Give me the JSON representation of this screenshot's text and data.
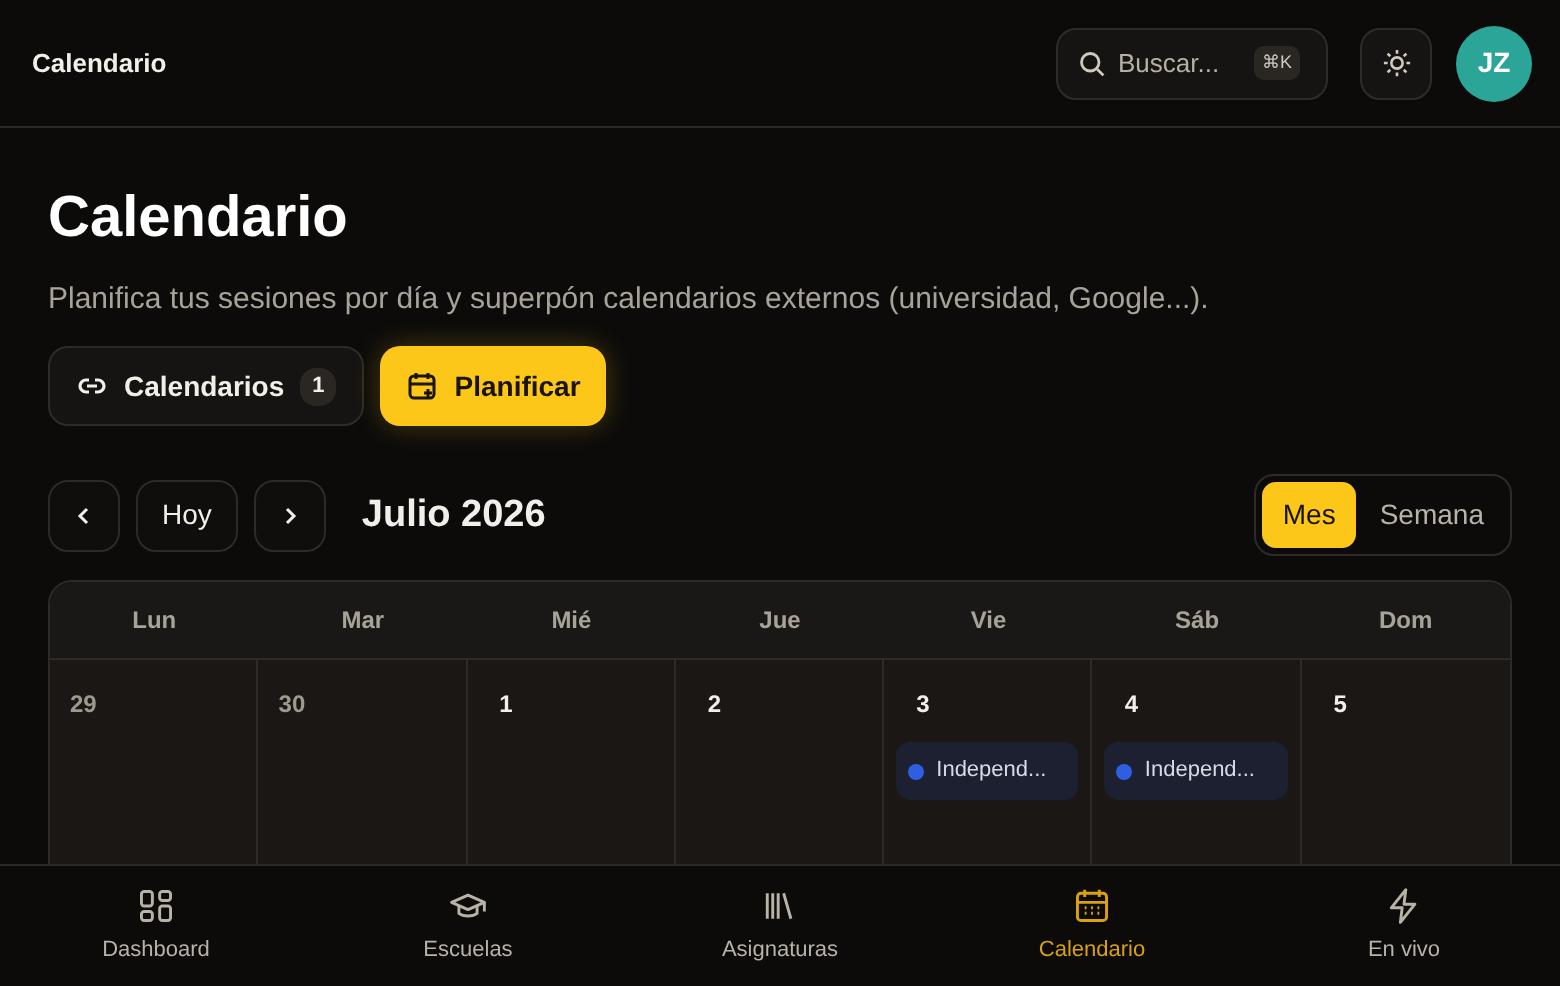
{
  "header": {
    "title": "Calendario",
    "search": {
      "placeholder": "Buscar...",
      "shortcut": "⌘K"
    },
    "avatar": "JZ"
  },
  "page": {
    "title": "Calendario",
    "subtitle": "Planifica tus sesiones por día y superpón calendarios externos (universidad, Google...)."
  },
  "actions": [
    {
      "kind": "link",
      "label": "Calendarios",
      "count": "1"
    },
    {
      "kind": "plan",
      "label": "Planificar"
    }
  ],
  "nav": {
    "today": "Hoy",
    "month_label": "Julio 2026"
  },
  "views": [
    {
      "label": "Mes",
      "selected": true
    },
    {
      "label": "Semana",
      "selected": false
    }
  ],
  "calendar": {
    "weekdays": [
      "Lun",
      "Mar",
      "Mié",
      "Jue",
      "Vie",
      "Sáb",
      "Dom"
    ],
    "days": [
      {
        "number": "29",
        "in_month": false
      },
      {
        "number": "30",
        "in_month": false
      },
      {
        "number": "1",
        "in_month": true
      },
      {
        "number": "2",
        "in_month": true
      },
      {
        "number": "3",
        "in_month": true,
        "events": [
          {
            "title": "Independ...",
            "color": "#2f5fe0"
          }
        ]
      },
      {
        "number": "4",
        "in_month": true,
        "events": [
          {
            "title": "Independ...",
            "color": "#2f5fe0"
          }
        ]
      },
      {
        "number": "5",
        "in_month": true
      }
    ]
  },
  "bottom_nav": [
    {
      "kind": "dashboard",
      "label": "Dashboard",
      "selected": false
    },
    {
      "kind": "school",
      "label": "Escuelas",
      "selected": false
    },
    {
      "kind": "library",
      "label": "Asignaturas",
      "selected": false
    },
    {
      "kind": "calendar",
      "label": "Calendario",
      "selected": true
    },
    {
      "kind": "live",
      "label": "En vivo",
      "selected": false
    }
  ]
}
